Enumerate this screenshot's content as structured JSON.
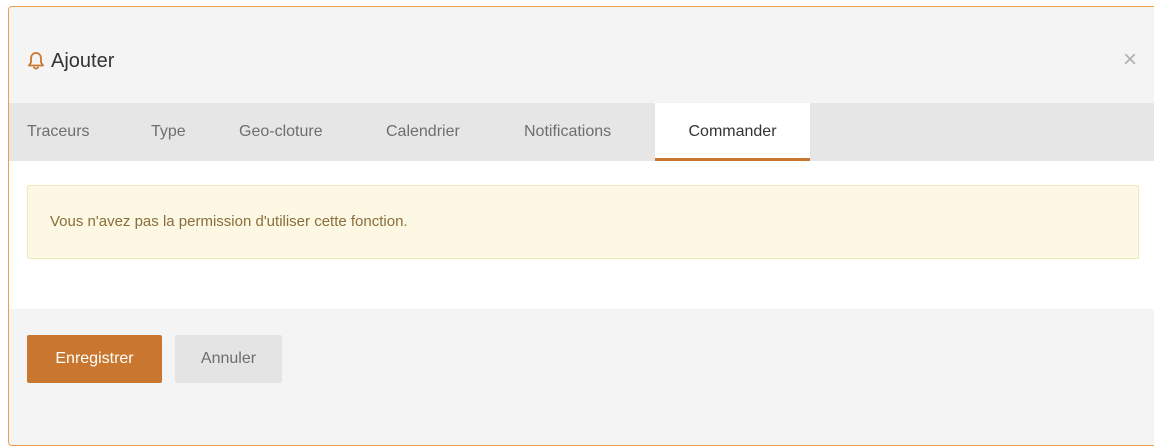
{
  "modal": {
    "title": "Ajouter",
    "title_icon": "bell-icon",
    "close_symbol": "×",
    "accent_color": "#c9772e"
  },
  "tabs": [
    {
      "label": "Traceurs",
      "active": false
    },
    {
      "label": "Type",
      "active": false
    },
    {
      "label": "Geo-cloture",
      "active": false
    },
    {
      "label": "Calendrier",
      "active": false
    },
    {
      "label": "Notifications",
      "active": false
    },
    {
      "label": "Commander",
      "active": true
    }
  ],
  "alert": {
    "message": "Vous n'avez pas la permission d'utiliser cette fonction."
  },
  "footer": {
    "save_label": "Enregistrer",
    "cancel_label": "Annuler"
  }
}
